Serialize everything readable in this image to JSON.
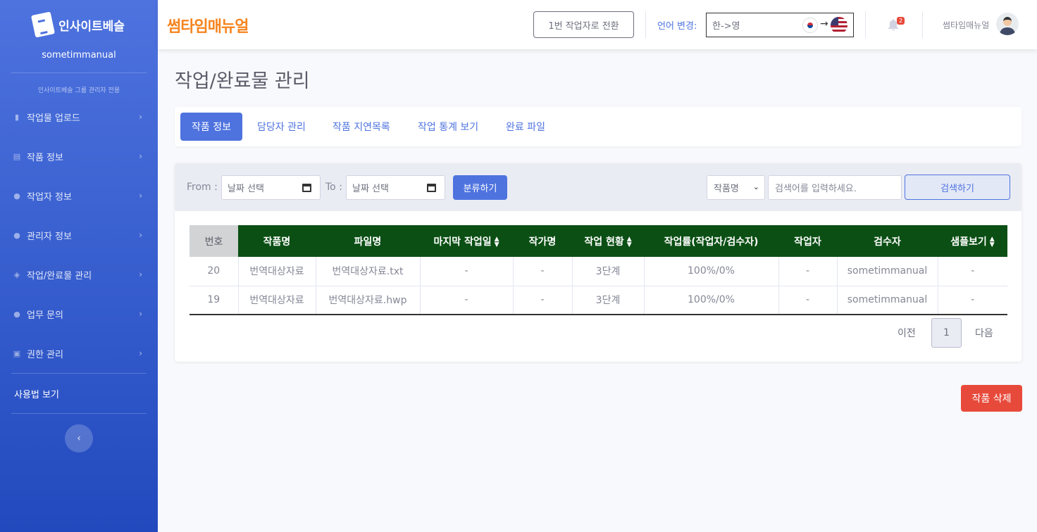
{
  "sidebar": {
    "brand": "인사이트베슬",
    "org_name": "sometimmanual",
    "heading": "인사이트베슬 그룹 관리자 전용",
    "items": [
      {
        "label": "작업물 업로드"
      },
      {
        "label": "작품 정보"
      },
      {
        "label": "작업자 정보"
      },
      {
        "label": "관리자 정보"
      },
      {
        "label": "작업/완료물 관리"
      },
      {
        "label": "업무 문의"
      },
      {
        "label": "권한 관리"
      }
    ],
    "help_label": "사용법 보기",
    "toggle_icon": "‹"
  },
  "topbar": {
    "logo_text": "썸타임매뉴얼",
    "switch_label": "1번 작업자로 전환",
    "lang_label": "언어 변경:",
    "lang_value": "한->영",
    "notification_count": "2",
    "user_name": "썸타임매뉴얼"
  },
  "page": {
    "title": "작업/완료물 관리",
    "tabs": [
      {
        "label": "작품 정보",
        "active": true
      },
      {
        "label": "담당자 관리"
      },
      {
        "label": "작품 지연목록"
      },
      {
        "label": "작업 통계 보기"
      },
      {
        "label": "완료 파일"
      }
    ]
  },
  "filter": {
    "from_label": "From :",
    "to_label": "To :",
    "from_placeholder": "날짜 선택",
    "to_placeholder": "날짜 선택",
    "classify_label": "분류하기",
    "select_value": "작품명",
    "search_placeholder": "검색어를 입력하세요.",
    "search_label": "검색하기"
  },
  "table": {
    "headers": [
      "번호",
      "작품명",
      "파일명",
      "마지막 작업일",
      "작가명",
      "작업 현황",
      "작업률(작업자/검수자)",
      "작업자",
      "검수자",
      "샘플보기"
    ],
    "rows": [
      [
        "20",
        "번역대상자료",
        "번역대상자료.txt",
        "-",
        "-",
        "3단계",
        "100%/0%",
        "-",
        "sometimmanual",
        "-"
      ],
      [
        "19",
        "번역대상자료",
        "번역대상자료.hwp",
        "-",
        "-",
        "3단계",
        "100%/0%",
        "-",
        "sometimmanual",
        "-"
      ]
    ]
  },
  "pager": {
    "prev": "이전",
    "page": "1",
    "next": "다음"
  },
  "delete_label": "작품 삭제",
  "colors": {
    "sidebar_top": "#4e73df",
    "sidebar_bottom": "#224abe",
    "header_green": "#0b4f14",
    "logo_orange": "#f6841f",
    "danger": "#e74a3b"
  }
}
